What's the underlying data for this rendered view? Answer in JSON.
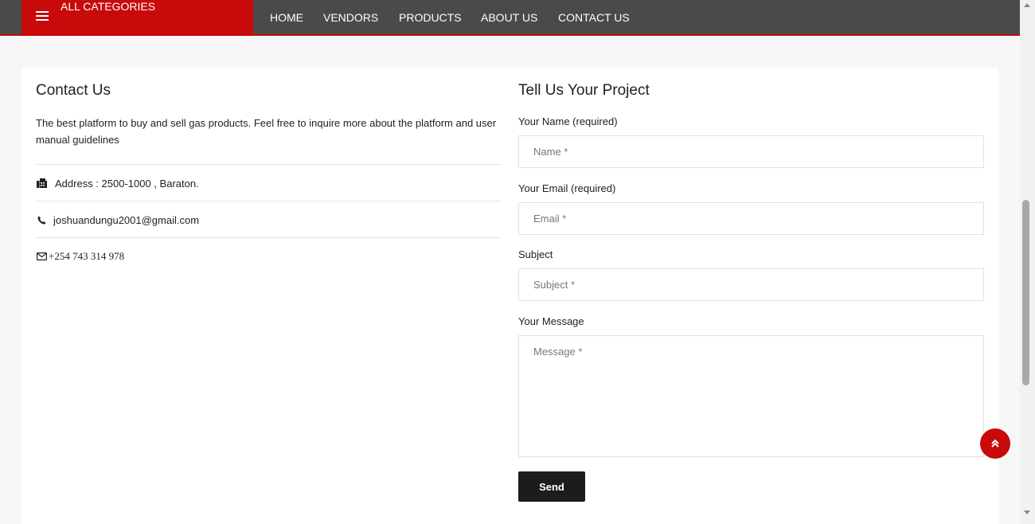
{
  "nav": {
    "categories_label": "ALL CATEGORIES",
    "links": [
      "HOME",
      "VENDORS",
      "PRODUCTS",
      "ABOUT US",
      "CONTACT US"
    ]
  },
  "contact": {
    "title": "Contact Us",
    "intro": "The best platform to buy and sell gas products. Feel free to inquire more about the platform and user manual guidelines",
    "address": "Address : 2500-1000 , Baraton.",
    "email": "joshuandungu2001@gmail.com",
    "phone": "+254 743 314 978"
  },
  "form": {
    "title": "Tell Us Your Project",
    "name_label": "Your Name (required)",
    "name_placeholder": "Name *",
    "email_label": "Your Email (required)",
    "email_placeholder": "Email *",
    "subject_label": "Subject",
    "subject_placeholder": "Subject *",
    "message_label": "Your Message",
    "message_placeholder": "Message *",
    "send_label": "Send"
  },
  "colors": {
    "accent": "#c80a0a",
    "nav_bg": "#4a4a4a",
    "button_bg": "#1c1c1c"
  },
  "icons": [
    "menu-icon",
    "fax-icon",
    "phone-icon",
    "envelope-icon",
    "double-chevron-up-icon"
  ]
}
